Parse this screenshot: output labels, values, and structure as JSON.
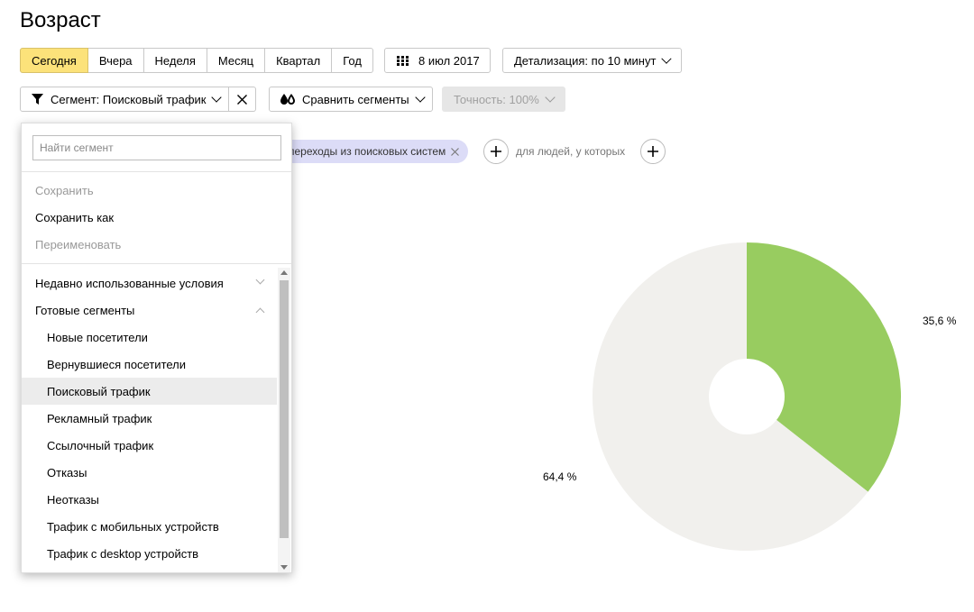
{
  "page": {
    "title": "Возраст"
  },
  "toolbar": {
    "periods": [
      "Сегодня",
      "Вчера",
      "Неделя",
      "Месяц",
      "Квартал",
      "Год"
    ],
    "active_period": "Сегодня",
    "date_label": "8 июл 2017",
    "detail_label": "Детализация: по 10 минут"
  },
  "segment_bar": {
    "segment_label": "Сегмент: Поисковый трафик",
    "compare_label": "Сравнить сегменты",
    "accuracy_label": "Точность: 100%"
  },
  "filter": {
    "chip_label": "переходы из поисковых систем",
    "people_label": "для людей, у которых"
  },
  "dropdown": {
    "search_placeholder": "Найти сегмент",
    "actions": [
      {
        "label": "Сохранить",
        "enabled": false
      },
      {
        "label": "Сохранить как",
        "enabled": true
      },
      {
        "label": "Переименовать",
        "enabled": false
      }
    ],
    "groups": [
      {
        "label": "Недавно использованные условия",
        "expanded": false,
        "items": []
      },
      {
        "label": "Готовые сегменты",
        "expanded": true,
        "items": [
          "Новые посетители",
          "Вернувшиеся посетители",
          "Поисковый трафик",
          "Рекламный трафик",
          "Ссылочный трафик",
          "Отказы",
          "Неотказы",
          "Трафик с мобильных устройств",
          "Трафик с desktop устройств"
        ]
      }
    ],
    "selected_item": "Поисковый трафик"
  },
  "chart_data": {
    "type": "pie",
    "values": [
      35.6,
      64.4
    ],
    "labels": [
      "35,6 %",
      "64,4 %"
    ],
    "colors": [
      "#98cc60",
      "#f1f0ed"
    ],
    "donut": true
  }
}
